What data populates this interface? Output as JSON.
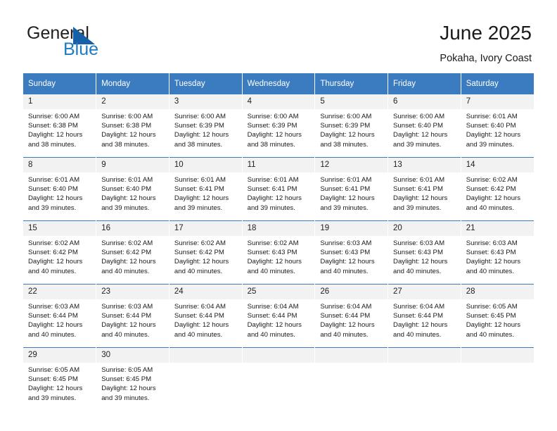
{
  "brand": {
    "name_part1": "General",
    "name_part2": "Blue",
    "accent_color": "#1f7bc1"
  },
  "header": {
    "title": "June 2025",
    "location": "Pokaha, Ivory Coast"
  },
  "calendar": {
    "header_color": "#3b7cc0",
    "weekday_headers": [
      "Sunday",
      "Monday",
      "Tuesday",
      "Wednesday",
      "Thursday",
      "Friday",
      "Saturday"
    ],
    "weeks": [
      [
        {
          "day": "1",
          "sunrise": "Sunrise: 6:00 AM",
          "sunset": "Sunset: 6:38 PM",
          "daylight_line1": "Daylight: 12 hours",
          "daylight_line2": "and 38 minutes."
        },
        {
          "day": "2",
          "sunrise": "Sunrise: 6:00 AM",
          "sunset": "Sunset: 6:38 PM",
          "daylight_line1": "Daylight: 12 hours",
          "daylight_line2": "and 38 minutes."
        },
        {
          "day": "3",
          "sunrise": "Sunrise: 6:00 AM",
          "sunset": "Sunset: 6:39 PM",
          "daylight_line1": "Daylight: 12 hours",
          "daylight_line2": "and 38 minutes."
        },
        {
          "day": "4",
          "sunrise": "Sunrise: 6:00 AM",
          "sunset": "Sunset: 6:39 PM",
          "daylight_line1": "Daylight: 12 hours",
          "daylight_line2": "and 38 minutes."
        },
        {
          "day": "5",
          "sunrise": "Sunrise: 6:00 AM",
          "sunset": "Sunset: 6:39 PM",
          "daylight_line1": "Daylight: 12 hours",
          "daylight_line2": "and 38 minutes."
        },
        {
          "day": "6",
          "sunrise": "Sunrise: 6:00 AM",
          "sunset": "Sunset: 6:40 PM",
          "daylight_line1": "Daylight: 12 hours",
          "daylight_line2": "and 39 minutes."
        },
        {
          "day": "7",
          "sunrise": "Sunrise: 6:01 AM",
          "sunset": "Sunset: 6:40 PM",
          "daylight_line1": "Daylight: 12 hours",
          "daylight_line2": "and 39 minutes."
        }
      ],
      [
        {
          "day": "8",
          "sunrise": "Sunrise: 6:01 AM",
          "sunset": "Sunset: 6:40 PM",
          "daylight_line1": "Daylight: 12 hours",
          "daylight_line2": "and 39 minutes."
        },
        {
          "day": "9",
          "sunrise": "Sunrise: 6:01 AM",
          "sunset": "Sunset: 6:40 PM",
          "daylight_line1": "Daylight: 12 hours",
          "daylight_line2": "and 39 minutes."
        },
        {
          "day": "10",
          "sunrise": "Sunrise: 6:01 AM",
          "sunset": "Sunset: 6:41 PM",
          "daylight_line1": "Daylight: 12 hours",
          "daylight_line2": "and 39 minutes."
        },
        {
          "day": "11",
          "sunrise": "Sunrise: 6:01 AM",
          "sunset": "Sunset: 6:41 PM",
          "daylight_line1": "Daylight: 12 hours",
          "daylight_line2": "and 39 minutes."
        },
        {
          "day": "12",
          "sunrise": "Sunrise: 6:01 AM",
          "sunset": "Sunset: 6:41 PM",
          "daylight_line1": "Daylight: 12 hours",
          "daylight_line2": "and 39 minutes."
        },
        {
          "day": "13",
          "sunrise": "Sunrise: 6:01 AM",
          "sunset": "Sunset: 6:41 PM",
          "daylight_line1": "Daylight: 12 hours",
          "daylight_line2": "and 39 minutes."
        },
        {
          "day": "14",
          "sunrise": "Sunrise: 6:02 AM",
          "sunset": "Sunset: 6:42 PM",
          "daylight_line1": "Daylight: 12 hours",
          "daylight_line2": "and 40 minutes."
        }
      ],
      [
        {
          "day": "15",
          "sunrise": "Sunrise: 6:02 AM",
          "sunset": "Sunset: 6:42 PM",
          "daylight_line1": "Daylight: 12 hours",
          "daylight_line2": "and 40 minutes."
        },
        {
          "day": "16",
          "sunrise": "Sunrise: 6:02 AM",
          "sunset": "Sunset: 6:42 PM",
          "daylight_line1": "Daylight: 12 hours",
          "daylight_line2": "and 40 minutes."
        },
        {
          "day": "17",
          "sunrise": "Sunrise: 6:02 AM",
          "sunset": "Sunset: 6:42 PM",
          "daylight_line1": "Daylight: 12 hours",
          "daylight_line2": "and 40 minutes."
        },
        {
          "day": "18",
          "sunrise": "Sunrise: 6:02 AM",
          "sunset": "Sunset: 6:43 PM",
          "daylight_line1": "Daylight: 12 hours",
          "daylight_line2": "and 40 minutes."
        },
        {
          "day": "19",
          "sunrise": "Sunrise: 6:03 AM",
          "sunset": "Sunset: 6:43 PM",
          "daylight_line1": "Daylight: 12 hours",
          "daylight_line2": "and 40 minutes."
        },
        {
          "day": "20",
          "sunrise": "Sunrise: 6:03 AM",
          "sunset": "Sunset: 6:43 PM",
          "daylight_line1": "Daylight: 12 hours",
          "daylight_line2": "and 40 minutes."
        },
        {
          "day": "21",
          "sunrise": "Sunrise: 6:03 AM",
          "sunset": "Sunset: 6:43 PM",
          "daylight_line1": "Daylight: 12 hours",
          "daylight_line2": "and 40 minutes."
        }
      ],
      [
        {
          "day": "22",
          "sunrise": "Sunrise: 6:03 AM",
          "sunset": "Sunset: 6:44 PM",
          "daylight_line1": "Daylight: 12 hours",
          "daylight_line2": "and 40 minutes."
        },
        {
          "day": "23",
          "sunrise": "Sunrise: 6:03 AM",
          "sunset": "Sunset: 6:44 PM",
          "daylight_line1": "Daylight: 12 hours",
          "daylight_line2": "and 40 minutes."
        },
        {
          "day": "24",
          "sunrise": "Sunrise: 6:04 AM",
          "sunset": "Sunset: 6:44 PM",
          "daylight_line1": "Daylight: 12 hours",
          "daylight_line2": "and 40 minutes."
        },
        {
          "day": "25",
          "sunrise": "Sunrise: 6:04 AM",
          "sunset": "Sunset: 6:44 PM",
          "daylight_line1": "Daylight: 12 hours",
          "daylight_line2": "and 40 minutes."
        },
        {
          "day": "26",
          "sunrise": "Sunrise: 6:04 AM",
          "sunset": "Sunset: 6:44 PM",
          "daylight_line1": "Daylight: 12 hours",
          "daylight_line2": "and 40 minutes."
        },
        {
          "day": "27",
          "sunrise": "Sunrise: 6:04 AM",
          "sunset": "Sunset: 6:44 PM",
          "daylight_line1": "Daylight: 12 hours",
          "daylight_line2": "and 40 minutes."
        },
        {
          "day": "28",
          "sunrise": "Sunrise: 6:05 AM",
          "sunset": "Sunset: 6:45 PM",
          "daylight_line1": "Daylight: 12 hours",
          "daylight_line2": "and 40 minutes."
        }
      ],
      [
        {
          "day": "29",
          "sunrise": "Sunrise: 6:05 AM",
          "sunset": "Sunset: 6:45 PM",
          "daylight_line1": "Daylight: 12 hours",
          "daylight_line2": "and 39 minutes."
        },
        {
          "day": "30",
          "sunrise": "Sunrise: 6:05 AM",
          "sunset": "Sunset: 6:45 PM",
          "daylight_line1": "Daylight: 12 hours",
          "daylight_line2": "and 39 minutes."
        },
        {
          "day": "",
          "sunrise": "",
          "sunset": "",
          "daylight_line1": "",
          "daylight_line2": ""
        },
        {
          "day": "",
          "sunrise": "",
          "sunset": "",
          "daylight_line1": "",
          "daylight_line2": ""
        },
        {
          "day": "",
          "sunrise": "",
          "sunset": "",
          "daylight_line1": "",
          "daylight_line2": ""
        },
        {
          "day": "",
          "sunrise": "",
          "sunset": "",
          "daylight_line1": "",
          "daylight_line2": ""
        },
        {
          "day": "",
          "sunrise": "",
          "sunset": "",
          "daylight_line1": "",
          "daylight_line2": ""
        }
      ]
    ]
  }
}
